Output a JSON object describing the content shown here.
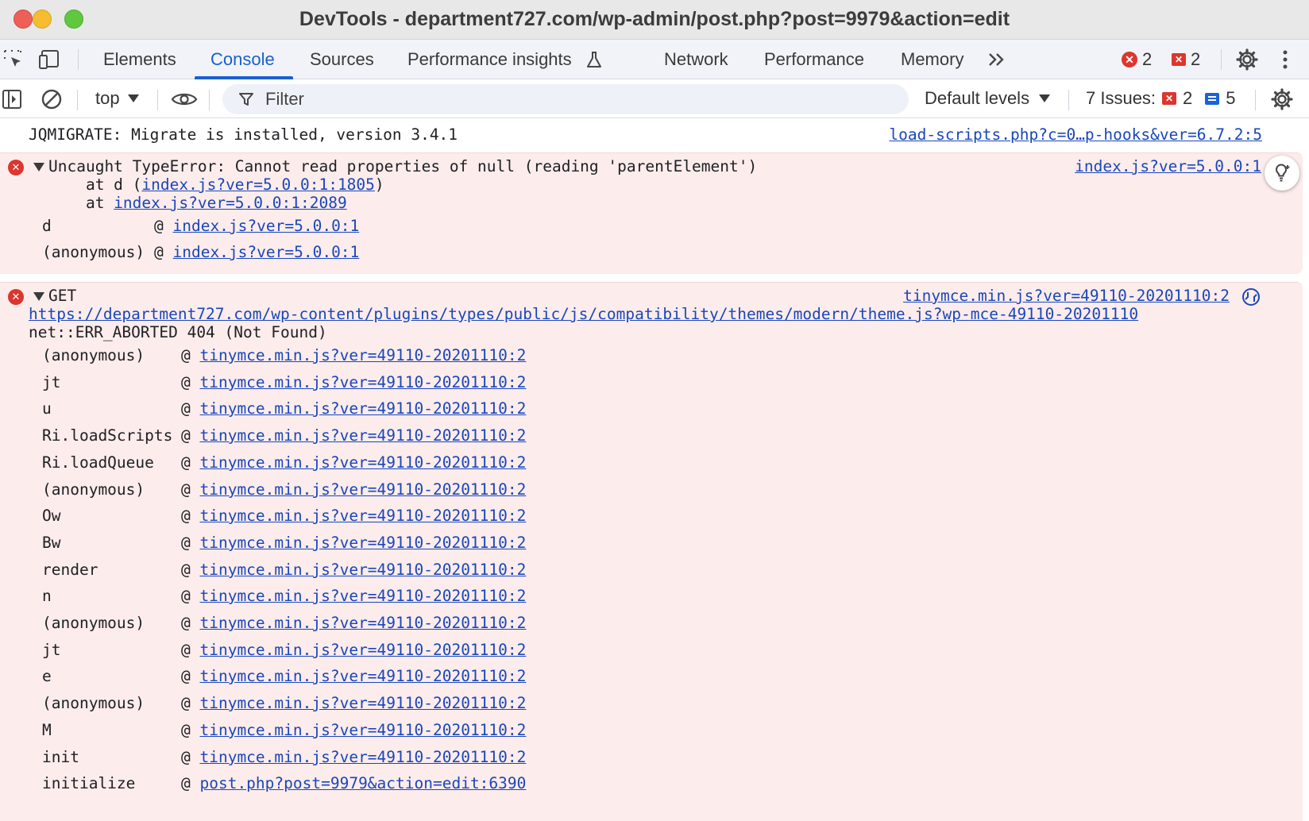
{
  "window": {
    "title": "DevTools - department727.com/wp-admin/post.php?post=9979&action=edit"
  },
  "tabs": {
    "items": [
      "Elements",
      "Console",
      "Sources",
      "Performance insights",
      "Network",
      "Performance",
      "Memory"
    ],
    "active": "Console",
    "error_count": "2",
    "issue_count": "2"
  },
  "toolbar": {
    "context": "top",
    "filter_placeholder": "Filter",
    "levels": "Default levels",
    "issues_label": "7 Issues:",
    "issues_errors": "2",
    "issues_info": "5"
  },
  "console": {
    "log1": {
      "text": "JQMIGRATE: Migrate is installed, version 3.4.1",
      "source": "load-scripts.php?c=0…p-hooks&ver=6.7.2:5"
    },
    "error1": {
      "message": "Uncaught TypeError: Cannot read properties of null (reading 'parentElement')",
      "source": "index.js?ver=5.0.0:1",
      "stack_line1_prefix": "    at d (",
      "stack_line1_link": "index.js?ver=5.0.0:1:1805",
      "stack_line1_suffix": ")",
      "stack_line2_prefix": "    at ",
      "stack_line2_link": "index.js?ver=5.0.0:1:2089",
      "frames": [
        {
          "name": "d",
          "source": "index.js?ver=5.0.0:1"
        },
        {
          "name": "(anonymous)",
          "source": "index.js?ver=5.0.0:1"
        }
      ]
    },
    "error2": {
      "method": "GET",
      "source": "tinymce.min.js?ver=49110-20201110:2",
      "url": "https://department727.com/wp-content/plugins/types/public/js/compatibility/themes/modern/theme.js?wp-mce-49110-20201110",
      "status": "net::ERR_ABORTED 404 (Not Found)",
      "frames": [
        {
          "name": "(anonymous)",
          "source": "tinymce.min.js?ver=49110-20201110:2"
        },
        {
          "name": "jt",
          "source": "tinymce.min.js?ver=49110-20201110:2"
        },
        {
          "name": "u",
          "source": "tinymce.min.js?ver=49110-20201110:2"
        },
        {
          "name": "Ri.loadScripts",
          "source": "tinymce.min.js?ver=49110-20201110:2"
        },
        {
          "name": "Ri.loadQueue",
          "source": "tinymce.min.js?ver=49110-20201110:2"
        },
        {
          "name": "(anonymous)",
          "source": "tinymce.min.js?ver=49110-20201110:2"
        },
        {
          "name": "Ow",
          "source": "tinymce.min.js?ver=49110-20201110:2"
        },
        {
          "name": "Bw",
          "source": "tinymce.min.js?ver=49110-20201110:2"
        },
        {
          "name": "render",
          "source": "tinymce.min.js?ver=49110-20201110:2"
        },
        {
          "name": "n",
          "source": "tinymce.min.js?ver=49110-20201110:2"
        },
        {
          "name": "(anonymous)",
          "source": "tinymce.min.js?ver=49110-20201110:2"
        },
        {
          "name": "jt",
          "source": "tinymce.min.js?ver=49110-20201110:2"
        },
        {
          "name": "e",
          "source": "tinymce.min.js?ver=49110-20201110:2"
        },
        {
          "name": "(anonymous)",
          "source": "tinymce.min.js?ver=49110-20201110:2"
        },
        {
          "name": "M",
          "source": "tinymce.min.js?ver=49110-20201110:2"
        },
        {
          "name": "init",
          "source": "tinymce.min.js?ver=49110-20201110:2"
        },
        {
          "name": "initialize",
          "source": "post.php?post=9979&action=edit:6390"
        }
      ]
    }
  },
  "colors": {
    "accent": "#1a5fd0",
    "error": "#dc362e",
    "error_bg": "#fcecec",
    "link": "#1a47b8"
  }
}
